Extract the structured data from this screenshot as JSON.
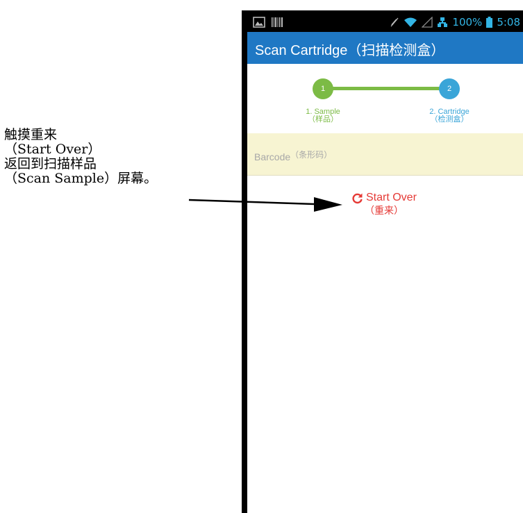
{
  "callout": {
    "line1": "触摸重来",
    "line2": "（Start Over）",
    "line3": "返回到扫描样品",
    "line4": "（Scan Sample）屏幕。"
  },
  "statusbar": {
    "battery_text": "100%",
    "time": "5:08",
    "icons": [
      "image-icon",
      "barcode-icon",
      "mute-icon",
      "wifi-icon",
      "signal-icon",
      "network-icon",
      "battery-icon"
    ]
  },
  "appbar": {
    "title": "Scan Cartridge（扫描检测盒）"
  },
  "stepper": {
    "step1_number": "1",
    "step1_label": "1. Sample",
    "step1_label_cn": "（样品）",
    "step2_number": "2",
    "step2_label": "2. Cartridge",
    "step2_label_cn": "（检测盒）",
    "colors": {
      "complete": "#7cbb45",
      "active": "#3aa5d8"
    }
  },
  "barcode": {
    "label": "Barcode",
    "label_cn": "（条形码）"
  },
  "start_over": {
    "label": "Start Over",
    "label_cn": "（重来）",
    "icon": "refresh-icon",
    "color": "#e53935"
  }
}
